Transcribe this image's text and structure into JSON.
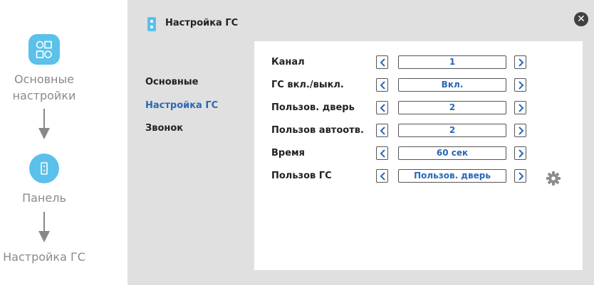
{
  "flow": {
    "step1_label": "Основные настройки",
    "step1_line1": "Основные",
    "step1_line2": "настройки",
    "step2_label": "Панель",
    "step3_label": "Настройка ГС"
  },
  "header": {
    "title": "Настройка ГС"
  },
  "nav": {
    "items": [
      {
        "label": "Основные",
        "active": false
      },
      {
        "label": "Настройка ГС",
        "active": true
      },
      {
        "label": "Звонок",
        "active": false
      }
    ]
  },
  "settings": [
    {
      "label": "Канал",
      "value": "1"
    },
    {
      "label": "ГС вкл./выкл.",
      "value": "Вкл."
    },
    {
      "label": "Пользов. дверь",
      "value": "2"
    },
    {
      "label": "Пользов автоотв.",
      "value": "2"
    },
    {
      "label": "Время",
      "value": "60 сек"
    },
    {
      "label": "Пользов ГС",
      "value": "Пользов. дверь"
    }
  ],
  "colors": {
    "accent": "#5bc0ea",
    "active_text": "#2a68b6",
    "panel_bg": "#e0e0e0"
  }
}
